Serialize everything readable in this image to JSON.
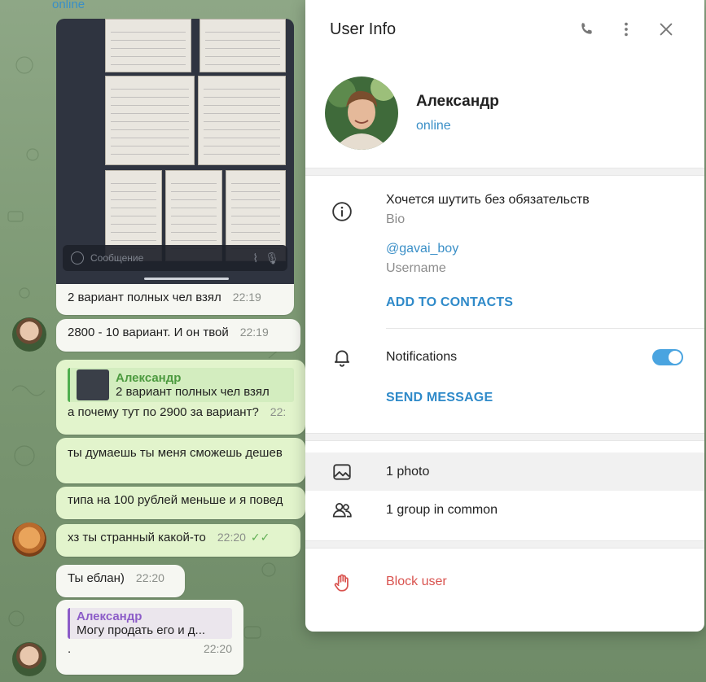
{
  "chat": {
    "header_status": "online",
    "photo_input_placeholder": "Сообщение",
    "messages": [
      {
        "text": "2 вариант полных чел взял",
        "time": "22:19"
      },
      {
        "text": "2800 - 10 вариант. И он твой",
        "time": "22:19"
      },
      {
        "quote_name": "Александр",
        "quote_text": "2 вариант полных чел взял",
        "text": "а почему тут по 2900 за вариант?",
        "time": "22:"
      },
      {
        "text": "ты думаешь ты меня сможешь дешев"
      },
      {
        "text": "типа на 100 рублей меньше и я повед"
      },
      {
        "text": "хз ты странный какой-то",
        "time": "22:20"
      },
      {
        "text": "Ты еблан)",
        "time": "22:20"
      },
      {
        "quote_name": "Александр",
        "quote_text": "Могу продать его и д...",
        "text": ".",
        "time": "22:20"
      }
    ]
  },
  "panel": {
    "title": "User Info",
    "header_icons": [
      "phone-icon",
      "more-vertical-icon",
      "close-icon"
    ],
    "name": "Александр",
    "status": "online",
    "bio": "Хочется шутить без обязательств",
    "bio_label": "Bio",
    "username": "@gavai_boy",
    "username_label": "Username",
    "add_to_contacts": "ADD TO CONTACTS",
    "notifications_label": "Notifications",
    "notifications_on": true,
    "send_message": "SEND MESSAGE",
    "photos": "1 photo",
    "groups": "1 group in common",
    "block": "Block user"
  },
  "colors": {
    "accent": "#3a8fc7",
    "toggle": "#4aa4e0",
    "danger": "#d9534f",
    "quote_green": "#4c9a3f",
    "quote_purple": "#8c5cc8"
  }
}
